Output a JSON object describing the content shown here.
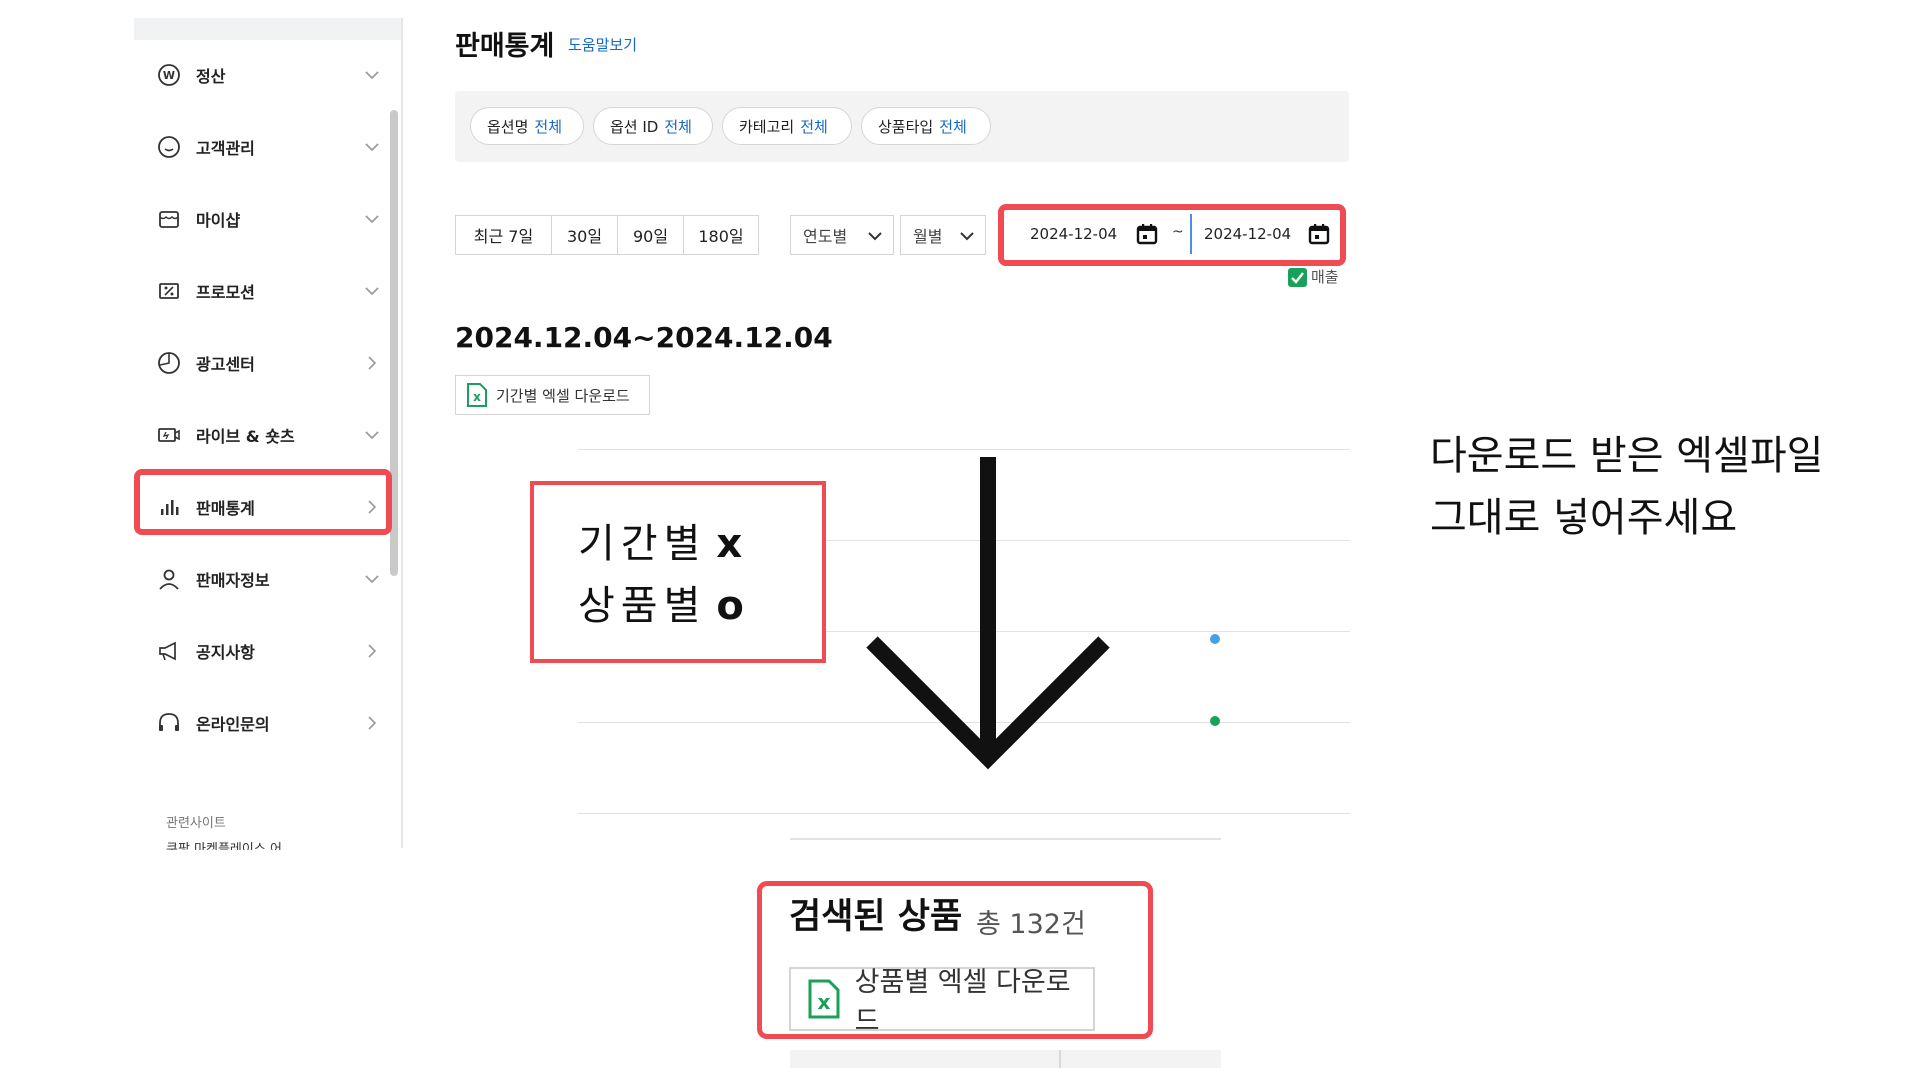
{
  "sidebar": {
    "items": [
      {
        "label": "정산",
        "icon": "won-icon",
        "chevron": "down"
      },
      {
        "label": "고객관리",
        "icon": "smile-icon",
        "chevron": "down"
      },
      {
        "label": "마이샵",
        "icon": "shop-icon",
        "chevron": "down"
      },
      {
        "label": "프로모션",
        "icon": "coupon-icon",
        "chevron": "down"
      },
      {
        "label": "광고센터",
        "icon": "pie-icon",
        "chevron": "right"
      },
      {
        "label": "라이브 & 숏츠",
        "icon": "live-icon",
        "chevron": "down"
      },
      {
        "label": "판매통계",
        "icon": "bar-chart-icon",
        "chevron": "right",
        "selected": true
      },
      {
        "label": "판매자정보",
        "icon": "person-icon",
        "chevron": "down"
      },
      {
        "label": "공지사항",
        "icon": "megaphone-icon",
        "chevron": "right"
      },
      {
        "label": "온라인문의",
        "icon": "headset-icon",
        "chevron": "right"
      }
    ],
    "related_label": "관련사이트",
    "related_cut": "쿠팡 마켓플레이스 어"
  },
  "header": {
    "title": "판매통계",
    "help": "도움말보기"
  },
  "filters": [
    {
      "label": "옵션명",
      "value": "전체"
    },
    {
      "label": "옵션 ID",
      "value": "전체"
    },
    {
      "label": "카테고리",
      "value": "전체"
    },
    {
      "label": "상품타입",
      "value": "전체"
    }
  ],
  "period_buttons": [
    "최근 7일",
    "30일",
    "90일",
    "180일"
  ],
  "dropdowns": {
    "year": "연도별",
    "month": "월별"
  },
  "date_range": {
    "start": "2024-12-04",
    "separator": "~",
    "end": "2024-12-04"
  },
  "sales_checkbox": {
    "label": "매출",
    "checked": true
  },
  "range_heading": "2024.12.04~2024.12.04",
  "period_excel_button": "기간별 엑셀 다운로드",
  "annotation": {
    "line1_text": "기간별",
    "line1_mark": "x",
    "line2_text": "상품별",
    "line2_mark": "o",
    "note_line1": "다운로드 받은 엑셀파일",
    "note_line2": "그대로 넣어주세요"
  },
  "products": {
    "title": "검색된 상품",
    "count": "총 132건",
    "excel_button": "상품별 엑셀 다운로드"
  },
  "colors": {
    "accent_red": "#f04a52",
    "link_blue": "#1668c7",
    "excel_green": "#19a05a",
    "dot_blue": "#4a9fe0",
    "dot_green": "#19a05a"
  }
}
